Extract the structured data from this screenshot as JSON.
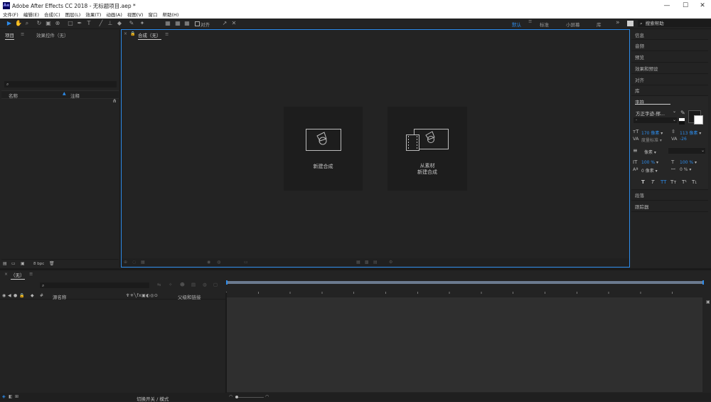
{
  "window": {
    "title": "Adobe After Effects CC 2018 - 无标题项目.aep *",
    "app_icon": "Ae"
  },
  "menu": [
    "文件(F)",
    "编辑(E)",
    "合成(C)",
    "图层(L)",
    "效果(T)",
    "动画(A)",
    "视图(V)",
    "窗口",
    "帮助(H)"
  ],
  "toolbar": {
    "align_label": "对齐",
    "workspaces": [
      "默认",
      "标准",
      "小屏幕",
      "库"
    ],
    "search_placeholder": "搜索帮助"
  },
  "project_panel": {
    "tabs": [
      "项目",
      "效果控件（无）"
    ],
    "columns": [
      "名称",
      "注释"
    ],
    "bpc": "8 bpc"
  },
  "comp_panel": {
    "tab_label": "合成（无）",
    "cards": [
      {
        "label": "新建合成",
        "icon": "new-composition-icon"
      },
      {
        "label_line1": "从素材",
        "label_line2": "新建合成",
        "icon": "composition-from-footage-icon"
      }
    ]
  },
  "right_panel": {
    "items": [
      "信息",
      "音频",
      "预览",
      "效果和预设",
      "对齐",
      "库"
    ],
    "character": {
      "title": "字符",
      "font_name": "方正字迹-邢...",
      "font_style": "-",
      "font_size": "170 像素",
      "leading": "113 像素",
      "kerning": "度量标准",
      "tracking": "-26",
      "stroke": "像素",
      "vscale": "100 %",
      "hscale": "100 %",
      "baseline": "0 像素",
      "tsume": "0 %",
      "styles": [
        "T",
        "T",
        "TT",
        "Tт",
        "T¹",
        "T₁"
      ]
    },
    "lower_items": [
      "段落",
      "跟踪器"
    ]
  },
  "timeline": {
    "tab_label": "（无）",
    "columns": [
      "源名称",
      "父级和链接"
    ],
    "footer_label": "切换开关 / 模式"
  },
  "colors": {
    "accent": "#2d8ceb",
    "panel_bg": "#232323",
    "field_bg": "#1b1b1b"
  }
}
